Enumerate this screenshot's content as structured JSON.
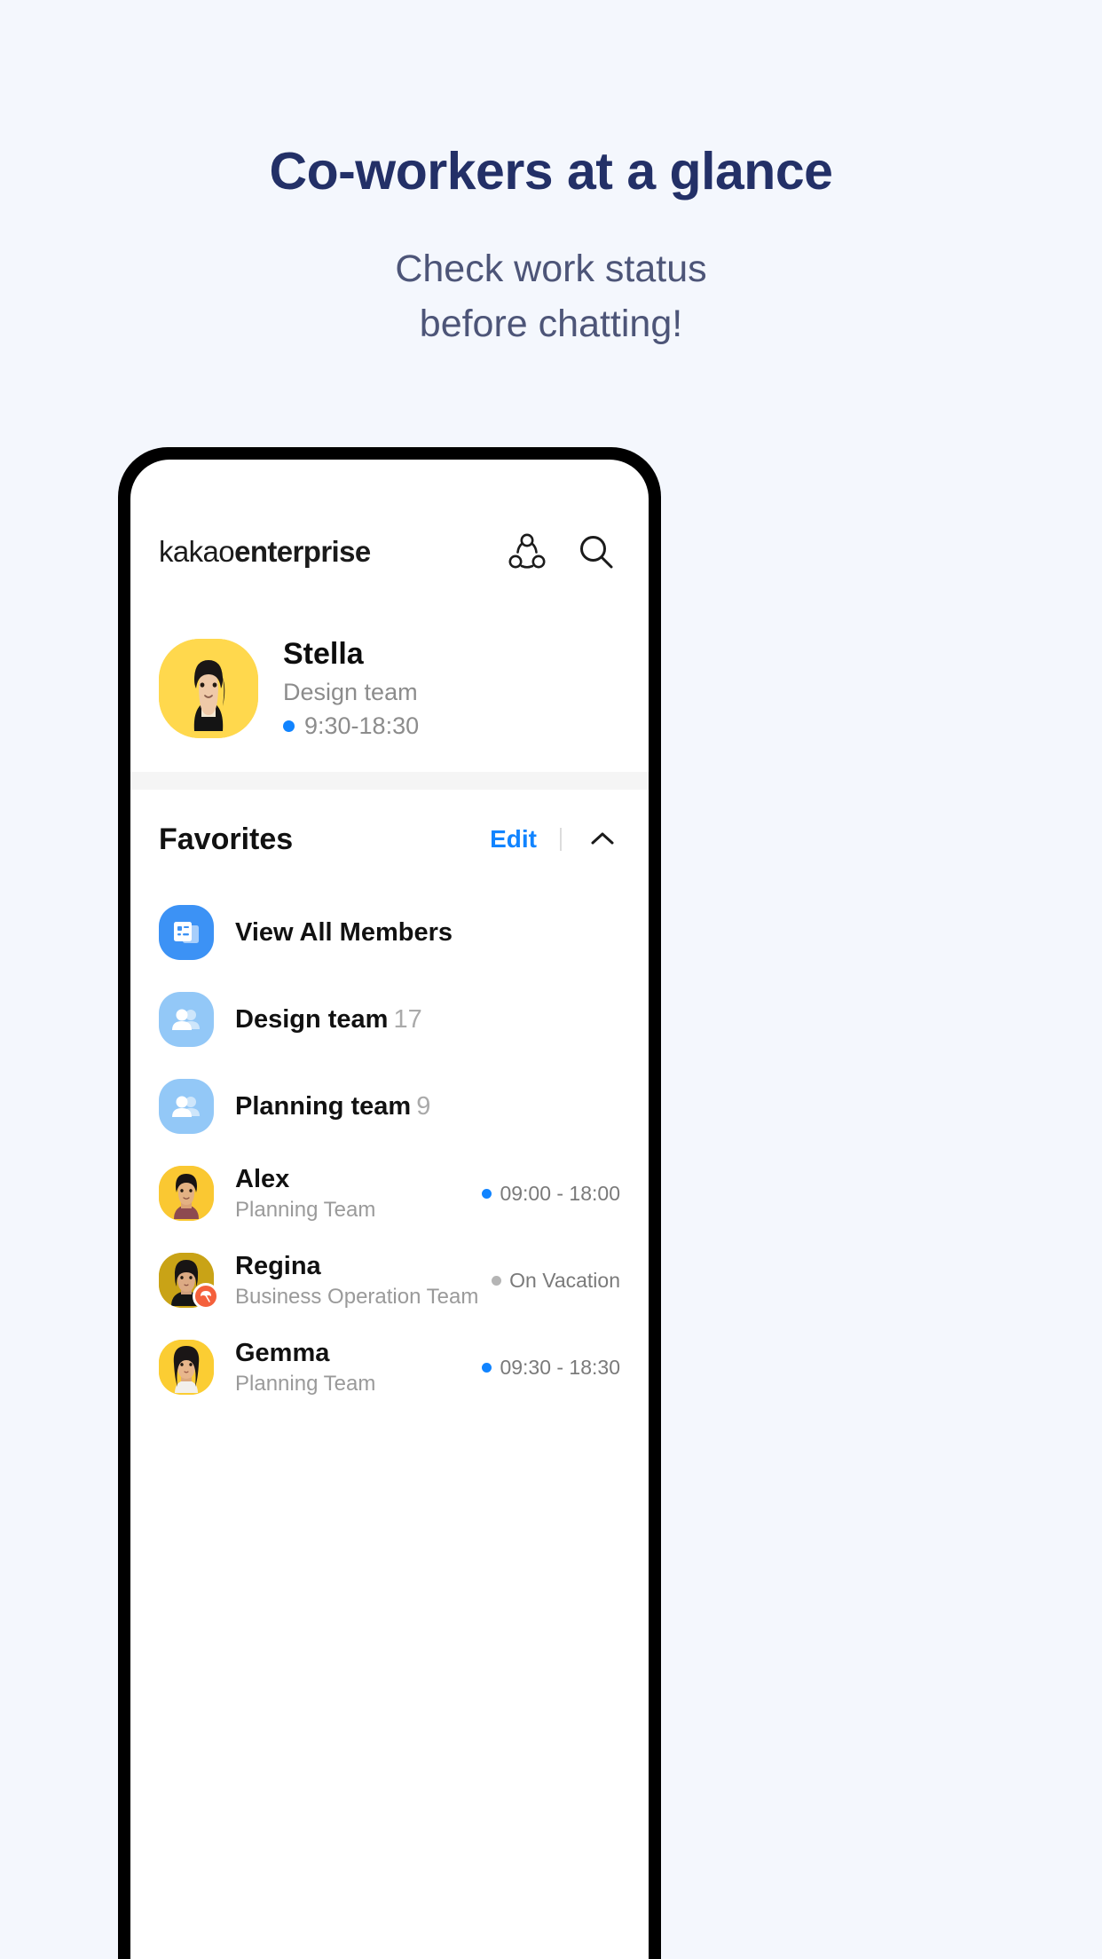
{
  "promo": {
    "title": "Co-workers at a glance",
    "subtitle_line1": "Check work status",
    "subtitle_line2": "before chatting!",
    "title_color": "#233067",
    "subtitle_color": "#4d5578",
    "background_color": "#f4f7fd"
  },
  "app": {
    "logo_light": "kakao",
    "logo_bold": "enterprise",
    "org_chart_icon": "org-network-icon",
    "search_icon": "search-icon"
  },
  "profile": {
    "name": "Stella",
    "team": "Design team",
    "work_hours": "9:30-18:30",
    "status_color": "#1184ff",
    "avatar_bg": "#ffd84d"
  },
  "favorites": {
    "title": "Favorites",
    "edit_label": "Edit",
    "edit_color": "#1184ff",
    "collapse_icon": "chevron-up-icon",
    "items": [
      {
        "type": "action",
        "label": "View All Members",
        "count": "",
        "sub": "",
        "status": "",
        "status_dot": "",
        "icon": "members-card-icon",
        "icon_bg": "#3c92f5"
      },
      {
        "type": "group",
        "label": "Design team",
        "count": "17",
        "sub": "",
        "status": "",
        "status_dot": "",
        "icon": "people-group-icon",
        "icon_bg": "#93c8f7"
      },
      {
        "type": "group",
        "label": "Planning team",
        "count": "9",
        "sub": "",
        "status": "",
        "status_dot": "",
        "icon": "people-group-icon",
        "icon_bg": "#93c8f7"
      },
      {
        "type": "person",
        "label": "Alex",
        "count": "",
        "sub": "Planning Team",
        "status": "09:00 - 18:00",
        "status_dot": "#1184ff",
        "icon": "avatar",
        "icon_bg": "#fac832",
        "badge": ""
      },
      {
        "type": "person",
        "label": "Regina",
        "count": "",
        "sub": "Business Operation Team",
        "status": "On Vacation",
        "status_dot": "#b5b5b5",
        "icon": "avatar",
        "icon_bg": "#c9a316",
        "badge": "vacation-umbrella-icon"
      },
      {
        "type": "person",
        "label": "Gemma",
        "count": "",
        "sub": "Planning Team",
        "status": "09:30 - 18:30",
        "status_dot": "#1184ff",
        "icon": "avatar",
        "icon_bg": "#fbcd33",
        "badge": ""
      }
    ]
  }
}
